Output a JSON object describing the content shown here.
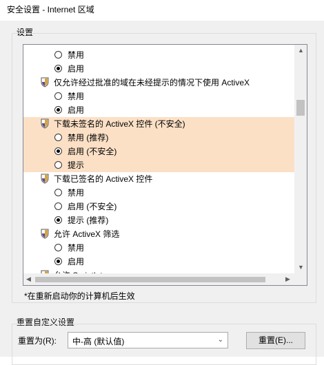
{
  "window": {
    "title": "安全设置 - Internet 区域"
  },
  "settings_group": {
    "label": "设置"
  },
  "settings_list": [
    {
      "kind": "radio",
      "label": "禁用",
      "checked": false,
      "highlight": false
    },
    {
      "kind": "radio",
      "label": "启用",
      "checked": true,
      "highlight": false
    },
    {
      "kind": "header",
      "label": "仅允许经过批准的域在未经提示的情况下使用 ActiveX",
      "highlight": false
    },
    {
      "kind": "radio",
      "label": "禁用",
      "checked": false,
      "highlight": false
    },
    {
      "kind": "radio",
      "label": "启用",
      "checked": true,
      "highlight": false
    },
    {
      "kind": "header",
      "label": "下载未签名的 ActiveX 控件 (不安全)",
      "highlight": true
    },
    {
      "kind": "radio",
      "label": "禁用 (推荐)",
      "checked": false,
      "highlight": true
    },
    {
      "kind": "radio",
      "label": "启用 (不安全)",
      "checked": true,
      "highlight": true
    },
    {
      "kind": "radio",
      "label": "提示",
      "checked": false,
      "highlight": true
    },
    {
      "kind": "header",
      "label": "下载已签名的 ActiveX 控件",
      "highlight": false
    },
    {
      "kind": "radio",
      "label": "禁用",
      "checked": false,
      "highlight": false
    },
    {
      "kind": "radio",
      "label": "启用 (不安全)",
      "checked": false,
      "highlight": false
    },
    {
      "kind": "radio",
      "label": "提示 (推荐)",
      "checked": true,
      "highlight": false
    },
    {
      "kind": "header",
      "label": "允许 ActiveX 筛选",
      "highlight": false
    },
    {
      "kind": "radio",
      "label": "禁用",
      "checked": false,
      "highlight": false
    },
    {
      "kind": "radio",
      "label": "启用",
      "checked": true,
      "highlight": false
    },
    {
      "kind": "header",
      "label": "允许 Scriptlet",
      "highlight": false
    }
  ],
  "note": "*在重新启动你的计算机后生效",
  "reset_group": {
    "label": "重置自定义设置",
    "reset_to_label": "重置为(R):",
    "combo_value": "中-高 (默认值)",
    "reset_button": "重置(E)..."
  },
  "colors": {
    "highlight": "#fbe0c6",
    "shield_gold": "#d8a53a",
    "shield_purple": "#5b4a9e"
  },
  "icons": {
    "setting_header": "shield-icon",
    "scroll_up": "chevron-up-icon",
    "scroll_down": "chevron-down-icon",
    "scroll_left": "chevron-left-icon",
    "scroll_right": "chevron-right-icon",
    "combo": "chevron-down-icon"
  }
}
